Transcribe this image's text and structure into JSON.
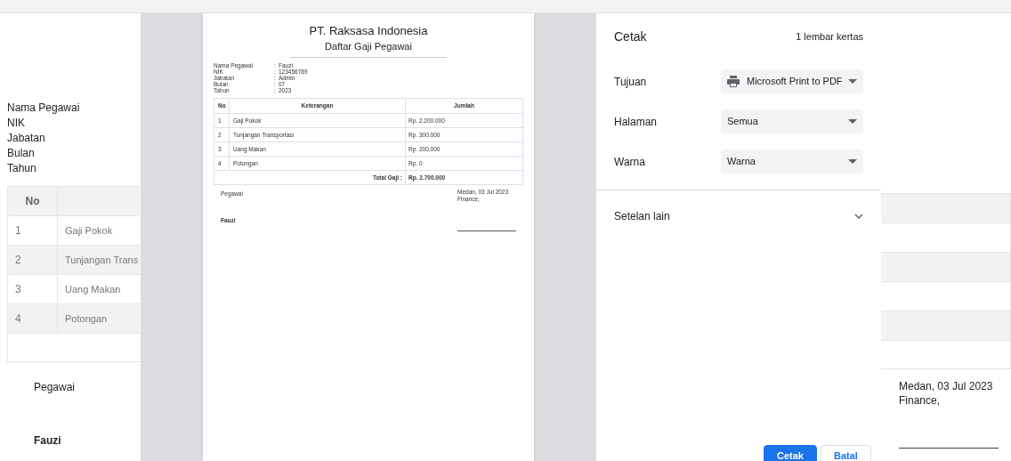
{
  "background_page": {
    "info_labels": [
      "Nama Pegawai",
      "NIK",
      "Jabatan",
      "Bulan",
      "Tahun"
    ],
    "table": {
      "columns": [
        "No"
      ],
      "rows": [
        {
          "no": "1",
          "keterangan": "Gaji Pokok"
        },
        {
          "no": "2",
          "keterangan": "Tunjangan Trans"
        },
        {
          "no": "3",
          "keterangan": "Uang Makan"
        },
        {
          "no": "4",
          "keterangan": "Potongan"
        }
      ]
    },
    "signature_left": {
      "role": "Pegawai",
      "name": "Fauzi"
    },
    "signature_right": {
      "place_date": "Medan, 03 Jul 2023",
      "role": "Finance,"
    }
  },
  "preview": {
    "company": "PT. Raksasa Indonesia",
    "title": "Daftar Gaji Pegawai",
    "info": [
      {
        "label": "Nama Pegawai",
        "separator": ":",
        "value": "Fauzi"
      },
      {
        "label": "NIK",
        "separator": ":",
        "value": "123456789"
      },
      {
        "label": "Jabatan",
        "separator": ":",
        "value": "Admin"
      },
      {
        "label": "Bulan",
        "separator": ":",
        "value": "07"
      },
      {
        "label": "Tahun",
        "separator": ":",
        "value": "2023"
      }
    ],
    "table": {
      "columns": [
        "No",
        "Keterangan",
        "Jumlah"
      ],
      "rows": [
        {
          "no": "1",
          "keterangan": "Gaji Pokok",
          "jumlah": "Rp. 2.200.000"
        },
        {
          "no": "2",
          "keterangan": "Tunjangan Transportasi",
          "jumlah": "Rp. 300.000"
        },
        {
          "no": "3",
          "keterangan": "Uang Makan",
          "jumlah": "Rp. 200.000"
        },
        {
          "no": "4",
          "keterangan": "Potongan",
          "jumlah": "Rp. 0"
        }
      ],
      "total_label": "Total Gaji :",
      "total_value": "Rp. 2.700.000"
    },
    "signature_left": {
      "role": "Pegawai",
      "name": "Fauzi"
    },
    "signature_right": {
      "place_date": "Medan, 03 Jul 2023",
      "role": "Finance,"
    }
  },
  "print_settings": {
    "title": "Cetak",
    "sheets": "1 lembar kertas",
    "fields": [
      {
        "label": "Tujuan",
        "value": "Microsoft Print to PDF",
        "kind": "printer"
      },
      {
        "label": "Halaman",
        "value": "Semua",
        "kind": "select"
      },
      {
        "label": "Warna",
        "value": "Warna",
        "kind": "select"
      }
    ],
    "more_settings": {
      "label": "Setelan lain",
      "expanded": false
    },
    "buttons": [
      {
        "label": "Cetak",
        "kind": "primary"
      },
      {
        "label": "Batal",
        "kind": "secondary"
      }
    ]
  }
}
